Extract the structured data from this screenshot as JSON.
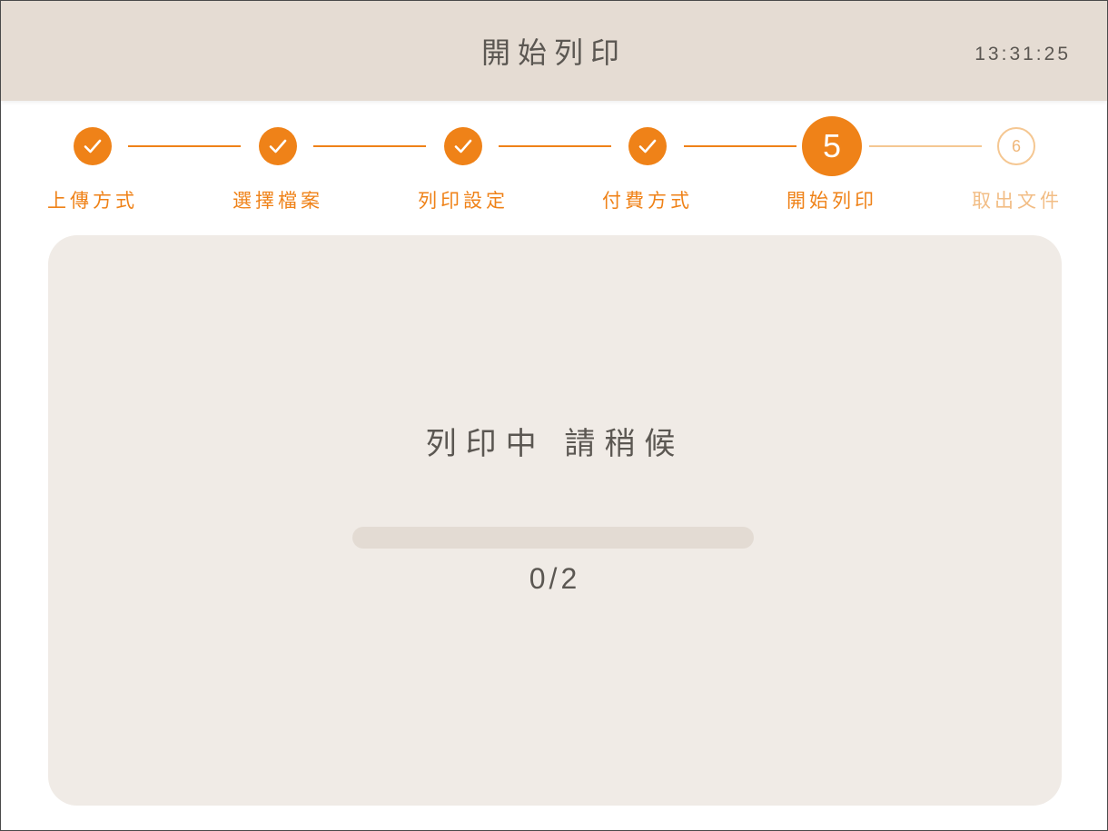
{
  "header": {
    "title": "開始列印",
    "clock": "13:31:25"
  },
  "stepper": {
    "steps": [
      {
        "label": "上傳方式",
        "state": "done",
        "icon": "check-icon"
      },
      {
        "label": "選擇檔案",
        "state": "done",
        "icon": "check-icon"
      },
      {
        "label": "列印設定",
        "state": "done",
        "icon": "check-icon"
      },
      {
        "label": "付費方式",
        "state": "done",
        "icon": "check-icon"
      },
      {
        "label": "開始列印",
        "state": "current",
        "number": "5"
      },
      {
        "label": "取出文件",
        "state": "pending",
        "number": "6"
      }
    ]
  },
  "main": {
    "status": "列印中 請稍候",
    "progress": {
      "done": 0,
      "total": 2,
      "text": "0/2"
    }
  },
  "colors": {
    "accent": "#ef8218",
    "accent_light": "#f5c792",
    "header_bg": "#e5dcd3",
    "panel_bg": "#f0ebe6",
    "text": "#5b5752"
  }
}
